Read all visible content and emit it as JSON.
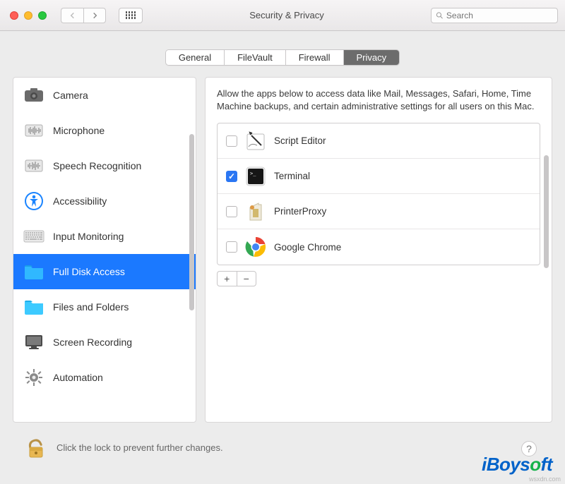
{
  "window": {
    "title": "Security & Privacy"
  },
  "search": {
    "placeholder": "Search"
  },
  "tabs": [
    {
      "label": "General",
      "active": false
    },
    {
      "label": "FileVault",
      "active": false
    },
    {
      "label": "Firewall",
      "active": false
    },
    {
      "label": "Privacy",
      "active": true
    }
  ],
  "sidebar": {
    "items": [
      {
        "label": "Camera",
        "icon": "camera-icon"
      },
      {
        "label": "Microphone",
        "icon": "microphone-icon"
      },
      {
        "label": "Speech Recognition",
        "icon": "speech-icon"
      },
      {
        "label": "Accessibility",
        "icon": "accessibility-icon"
      },
      {
        "label": "Input Monitoring",
        "icon": "keyboard-icon"
      },
      {
        "label": "Full Disk Access",
        "icon": "folder-icon",
        "selected": true
      },
      {
        "label": "Files and Folders",
        "icon": "folder-icon"
      },
      {
        "label": "Screen Recording",
        "icon": "screen-icon"
      },
      {
        "label": "Automation",
        "icon": "gear-icon"
      }
    ]
  },
  "main": {
    "description": "Allow the apps below to access data like Mail, Messages, Safari, Home, Time Machine backups, and certain administrative settings for all users on this Mac.",
    "apps": [
      {
        "name": "Script Editor",
        "checked": false,
        "icon": "script-editor-icon"
      },
      {
        "name": "Terminal",
        "checked": true,
        "icon": "terminal-icon"
      },
      {
        "name": "PrinterProxy",
        "checked": false,
        "icon": "printer-proxy-icon"
      },
      {
        "name": "Google Chrome",
        "checked": false,
        "icon": "chrome-icon"
      }
    ],
    "add": "+",
    "remove": "−"
  },
  "footer": {
    "lock_text": "Click the lock to prevent further changes."
  },
  "watermark": {
    "brand_prefix": "iBoys",
    "brand_dot": "o",
    "brand_suffix": "ft",
    "source": "wsxdn.com"
  },
  "colors": {
    "accent": "#1b79ff",
    "mac_blue": "#2a76f3"
  }
}
